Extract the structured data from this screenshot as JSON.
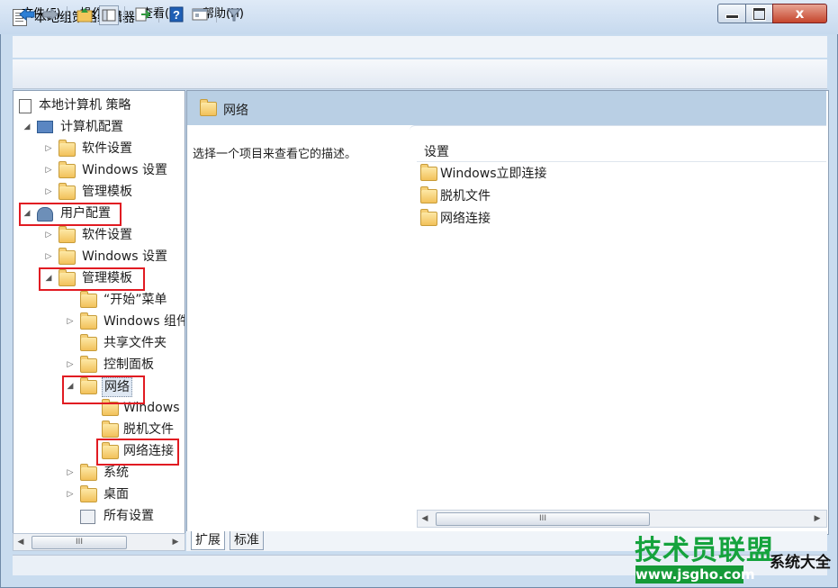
{
  "window": {
    "title": "本地组策略编辑器",
    "close_glyph": "x"
  },
  "menu": [
    {
      "label": "文件(F)"
    },
    {
      "label": "操作(A)"
    },
    {
      "label": "查看(V)"
    },
    {
      "label": "帮助(H)"
    }
  ],
  "toolbar": {
    "icons": [
      "back-arrow-icon",
      "forward-arrow-icon",
      "up-folder-icon",
      "show-hide-tree-icon",
      "export-list-icon",
      "help-icon",
      "properties-icon",
      "filter-icon"
    ]
  },
  "tree": {
    "root": "本地计算机 策略",
    "computer_config": "计算机配置",
    "cc_software": "软件设置",
    "cc_windows": "Windows 设置",
    "cc_admin": "管理模板",
    "user_config": "用户配置",
    "uc_software": "软件设置",
    "uc_windows": "Windows 设置",
    "uc_admin": "管理模板",
    "start_menu": "“开始”菜单",
    "windows_components": "Windows 组件",
    "shared_folders": "共享文件夹",
    "control_panel": "控制面板",
    "network": "网络",
    "net_windows": "Windows",
    "net_offline": "脱机文件",
    "net_connections": "网络连接",
    "system": "系统",
    "desktop": "桌面",
    "all_settings": "所有设置"
  },
  "left_scrollbar": {
    "thumb": "III"
  },
  "right": {
    "header_title": "网络",
    "description": "选择一个项目来查看它的描述。",
    "column_header": "设置",
    "items": [
      "Windows立即连接",
      "脱机文件",
      "网络连接"
    ],
    "scroll_thumb": "III"
  },
  "tabs": [
    "扩展",
    "标准"
  ],
  "watermark": {
    "main": "技术员联盟",
    "side": "系统大全",
    "url": "www.jsgho.com"
  },
  "colors": {
    "highlight": "#e11b22",
    "header_band": "#b9cfe4",
    "watermark_green": "#15a33d"
  }
}
